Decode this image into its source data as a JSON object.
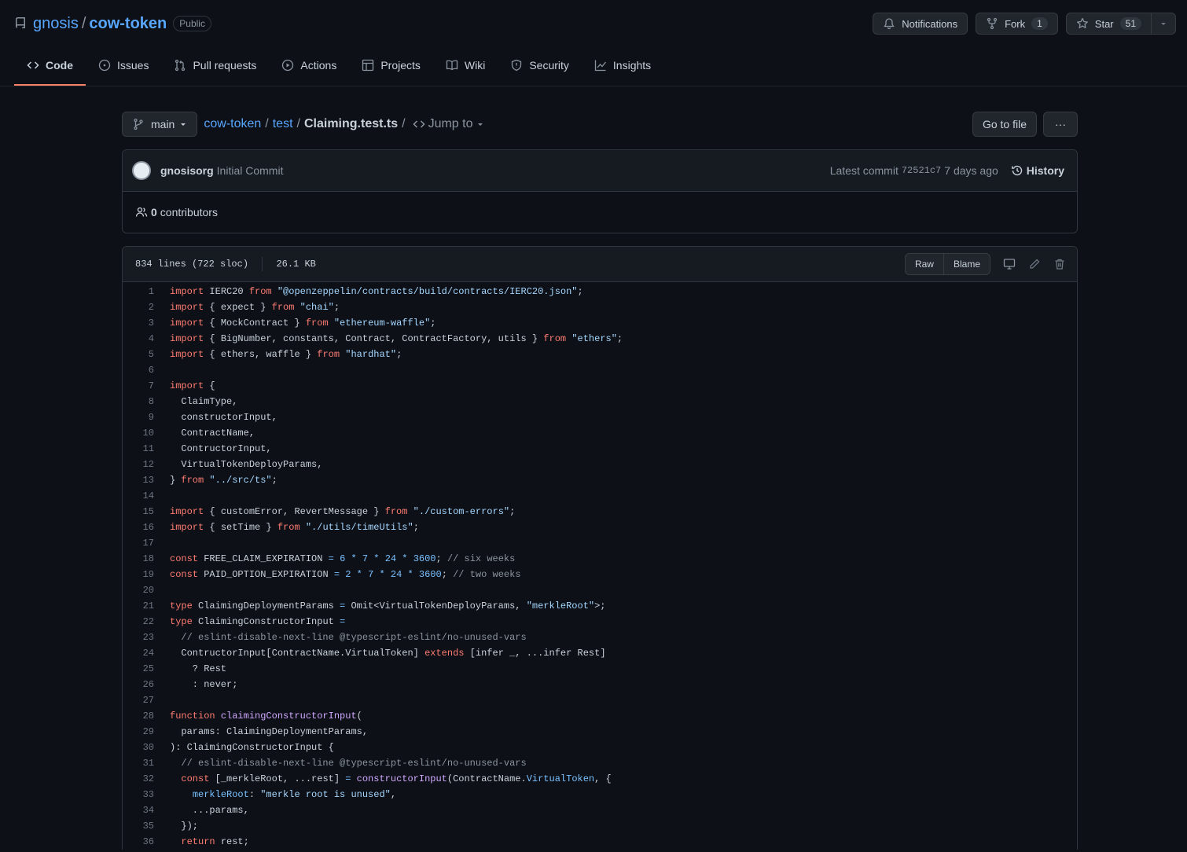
{
  "repo": {
    "owner": "gnosis",
    "separator": "/",
    "name": "cow-token",
    "visibility": "Public"
  },
  "header_actions": {
    "notifications": "Notifications",
    "fork": "Fork",
    "fork_count": "1",
    "star": "Star",
    "star_count": "51"
  },
  "tabs": [
    {
      "label": "Code",
      "icon": "code-icon",
      "active": true
    },
    {
      "label": "Issues",
      "icon": "issue-icon"
    },
    {
      "label": "Pull requests",
      "icon": "pull-request-icon"
    },
    {
      "label": "Actions",
      "icon": "play-icon"
    },
    {
      "label": "Projects",
      "icon": "table-icon"
    },
    {
      "label": "Wiki",
      "icon": "book-icon"
    },
    {
      "label": "Security",
      "icon": "shield-icon"
    },
    {
      "label": "Insights",
      "icon": "graph-icon"
    }
  ],
  "path": {
    "branch": "main",
    "crumbs": [
      "cow-token",
      "test"
    ],
    "file": "Claiming.test.ts",
    "jump_to": "Jump to",
    "go_to_file": "Go to file",
    "more": "···"
  },
  "commit": {
    "author": "gnosisorg",
    "message": "Initial Commit",
    "latest_label": "Latest commit",
    "sha": "72521c7",
    "time": "7 days ago",
    "history": "History",
    "contributors_count": "0",
    "contributors_label": "contributors"
  },
  "file": {
    "lines_info": "834 lines (722 sloc)",
    "size": "26.1 KB",
    "raw": "Raw",
    "blame": "Blame"
  },
  "code_lines": [
    "1",
    "2",
    "3",
    "4",
    "5",
    "6",
    "7",
    "8",
    "9",
    "10",
    "11",
    "12",
    "13",
    "14",
    "15",
    "16",
    "17",
    "18",
    "19",
    "20",
    "21",
    "22",
    "23",
    "24",
    "25",
    "26",
    "27",
    "28",
    "29",
    "30",
    "31",
    "32",
    "33",
    "34",
    "35",
    "36"
  ],
  "colors": {
    "accent_link": "#58a6ff",
    "active_tab": "#f78166",
    "keyword": "#ff7b72",
    "string": "#a5d6ff",
    "comment": "#8b949e",
    "number": "#79c0ff",
    "function": "#d2a8ff"
  }
}
